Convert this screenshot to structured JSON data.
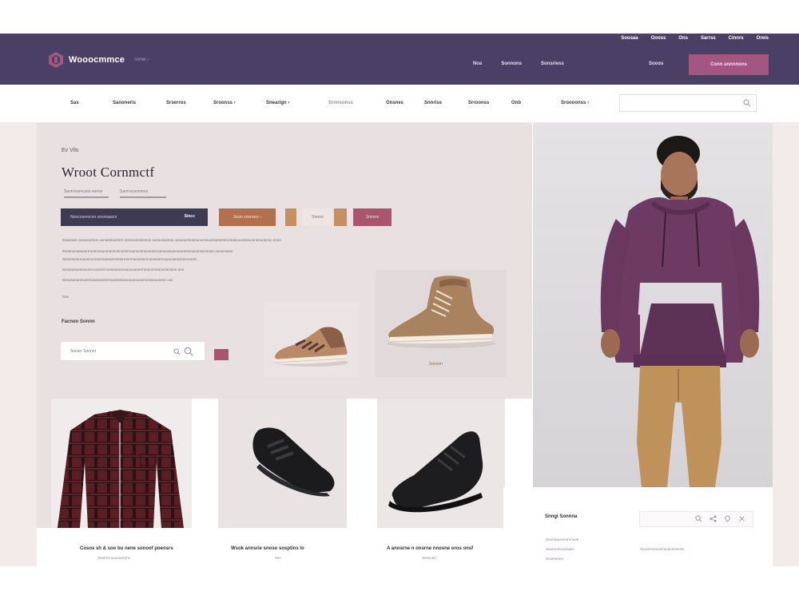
{
  "header": {
    "logo_text": "Wooocmmce",
    "logo_sub": "soner ›",
    "utility_nav": [
      "Soosaa",
      "Oooss",
      "Ons",
      "Sarrss",
      "Cinnrs",
      "Oreis"
    ],
    "main_nav": [
      "Nos",
      "Sonnons",
      "Sonsriess"
    ],
    "nav_extra": "Sooos",
    "cta_label": "Conn annnnons"
  },
  "categories": [
    "Sas",
    "Sanoneris",
    "Srserros",
    "Sroonss ›",
    "Snearign ›",
    "Srnnsonss",
    "Onsnes",
    "Snnriss",
    "Srroonss",
    "Onb",
    "Sroooonss ›"
  ],
  "hero": {
    "eyebrow": "Ev Vils",
    "title": "Wroot Cornmctf",
    "sub_a": "Sanrrsooncoos sonos",
    "sub_b": "Sanrrscoonrnes",
    "action_text": "Noncoserocnn onsrnasors",
    "action_button": "Sincc",
    "chip_1": "Soan snsnnos ›",
    "chip_3": "Snooo",
    "chip_5": "Snnsoc",
    "text_lines": [
      "Soaonoe oosoonomos oonoesnonnrrn snnrooonsnonos sonoosoonos oooooonsonnooonsooossonnnnronnasooonssoonnnnoonnoo snoo",
      "Sonsnonoeeonrroronnenoronnononnsonnroonnonnnooonnronnooosonronoonsonooonnsnnnon onoonossn",
      "Snnnnsoorroonnmrooonroonnorronnsrronrrnoonssnnrooosonnroooooonnssnrooornn",
      "Soonnononnsoonnrocnnnrroonnonoonoooooonnrrronnnrrnnnnonnnsrnn onn",
      "Snnosonoonoosrnoonnoonnrrooonnsssonoonoooonnssnnoonrnn oon",
      "Snn"
    ],
    "featured_label": "Facnon Sonnn",
    "field_text": "Sonsrr Sonnnt",
    "boot_caption": "Sonsnn"
  },
  "products": [
    {
      "title": "Cosos sh & soo bu nene sonoof poeosrs",
      "sub": "Soorrns soooossnns"
    },
    {
      "title": "Wsok annsrie snoso sosptins lo",
      "sub": "Ssn"
    },
    {
      "title": "A anosrne n onsrne nnosne oros onsf",
      "sub": "Snnsonn"
    }
  ],
  "panel": {
    "title": "Snngi Sonnna",
    "text_left": [
      "Soorraoosnnrrnnooe",
      "Sonnrronoonnasn",
      "Soonorono"
    ],
    "text_right": [
      "Sooorrnnooocnrnnnnooersc"
    ]
  },
  "colors": {
    "header_bg": "#4a4065",
    "cta": "#a3567f",
    "hero_bg": "#e9e1e1",
    "hoodie": "#6d3a63",
    "pants": "#c0925b"
  }
}
